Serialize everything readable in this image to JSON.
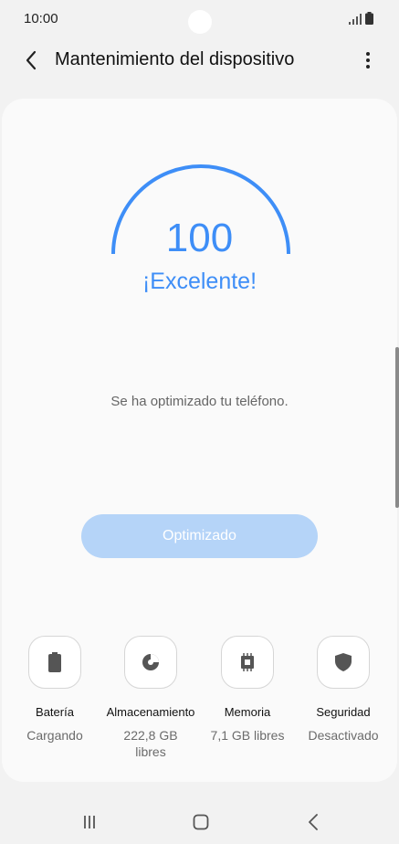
{
  "status_bar": {
    "time": "10:00",
    "signal_icon": "signal-icon",
    "battery_icon": "battery-icon"
  },
  "app_bar": {
    "title": "Mantenimiento del dispositivo",
    "back_icon": "back-arrow-icon",
    "more_icon": "more-vertical-icon"
  },
  "score": {
    "value": "100",
    "label": "¡Excelente!",
    "gauge_level": 1.0
  },
  "message": "Se ha optimizado tu teléfono.",
  "optimize_button": {
    "label": "Optimizado"
  },
  "features": [
    {
      "icon": "battery-icon",
      "label": "Batería",
      "status": "Cargando"
    },
    {
      "icon": "storage-icon",
      "label": "Almacenamiento",
      "status": "222,8 GB libres"
    },
    {
      "icon": "memory-icon",
      "label": "Memoria",
      "status": "7,1 GB libres"
    },
    {
      "icon": "shield-icon",
      "label": "Seguridad",
      "status": "Desactivado"
    }
  ],
  "nav_bar": {
    "recents_icon": "recents-icon",
    "home_icon": "home-icon",
    "back_icon": "back-icon"
  },
  "colors": {
    "accent": "#3e8ef7",
    "button_disabled": "#b5d4f8",
    "background": "#f2f2f2"
  }
}
